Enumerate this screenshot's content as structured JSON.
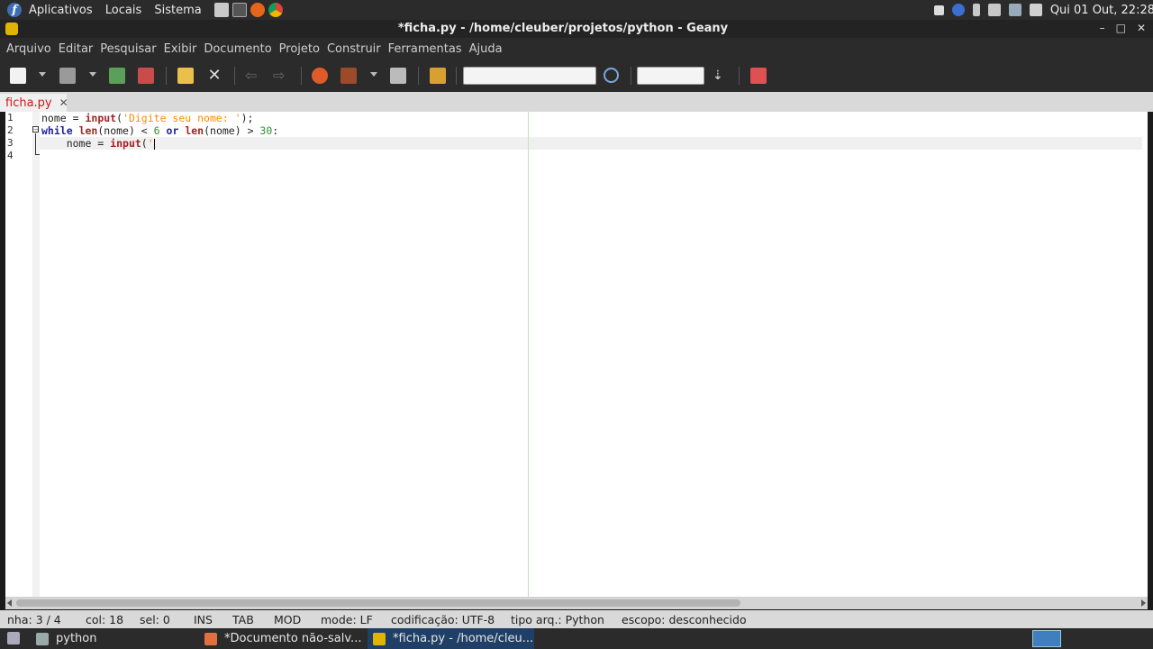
{
  "top_panel": {
    "menus": [
      "Aplicativos",
      "Locais",
      "Sistema"
    ],
    "clock": "Qui 01 Out, 22:28"
  },
  "window": {
    "title": "*ficha.py - /home/cleuber/projetos/python - Geany",
    "buttons": [
      "–",
      "□",
      "✕"
    ]
  },
  "menubar": [
    "Arquivo",
    "Editar",
    "Pesquisar",
    "Exibir",
    "Documento",
    "Projeto",
    "Construir",
    "Ferramentas",
    "Ajuda"
  ],
  "toolbar": {
    "search_value": "",
    "goto_value": ""
  },
  "tab": {
    "label": "ficha.py",
    "close": "✕"
  },
  "editor": {
    "line_numbers": [
      "1",
      "2",
      "3",
      "4"
    ]
  },
  "statusbar": {
    "line": "nha: 3 / 4",
    "col": "col: 18",
    "sel": "sel: 0",
    "ins": "INS",
    "tab": "TAB",
    "mod": "MOD",
    "mode": "mode: LF",
    "encoding": "codificação: UTF-8",
    "filetype": "tipo arq.: Python",
    "scope": "escopo: desconhecido"
  },
  "taskbar": {
    "items": [
      "python",
      "*Documento não-salv...",
      "*ficha.py - /home/cleu..."
    ]
  }
}
